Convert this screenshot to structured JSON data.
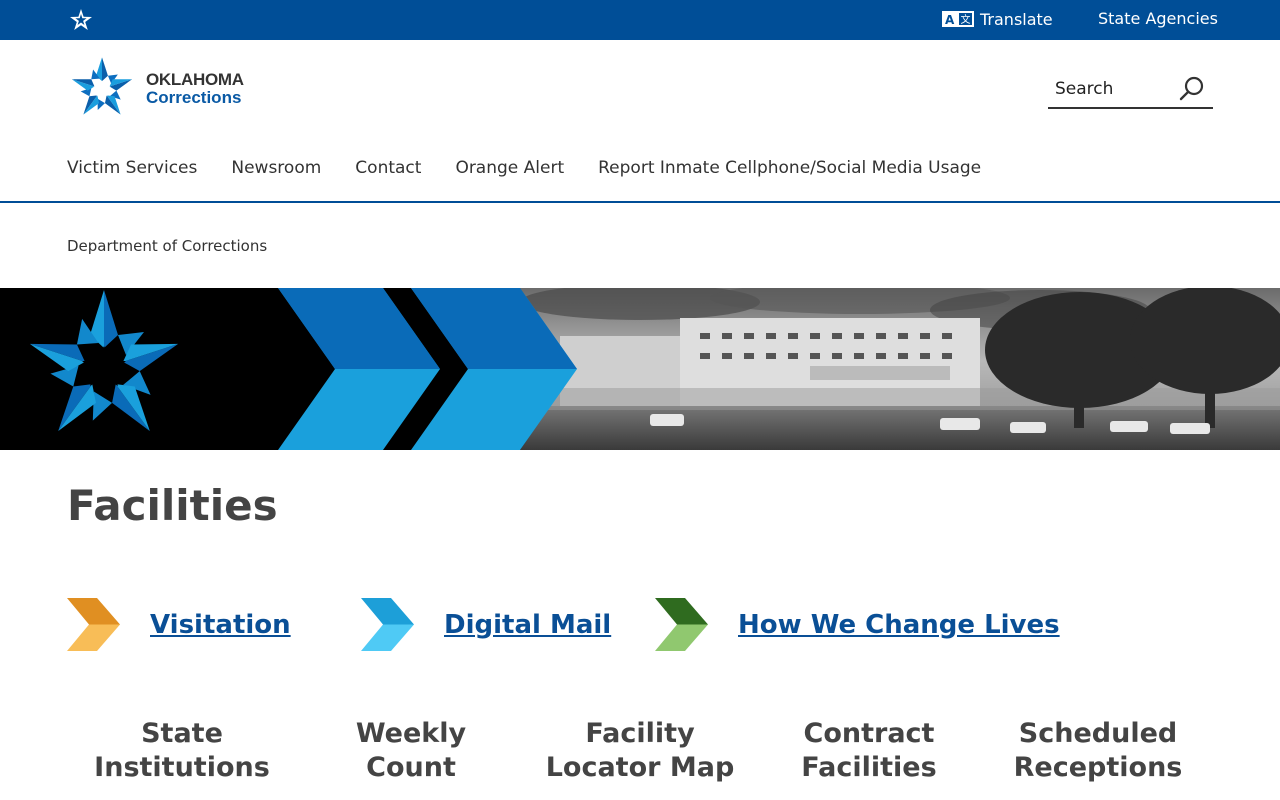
{
  "topbar": {
    "translate_label": "Translate",
    "translate_icon": "translate-icon",
    "agencies_label": "State Agencies",
    "bg_color": "#004e97"
  },
  "logo": {
    "line1": "OKLAHOMA",
    "line2": "Corrections"
  },
  "search": {
    "placeholder": "Search",
    "icon": "search-icon"
  },
  "nav": {
    "items": [
      "Victim Services",
      "Newsroom",
      "Contact",
      "Orange Alert",
      "Report Inmate Cellphone/Social Media Usage"
    ]
  },
  "breadcrumb": {
    "current": "Department of Corrections"
  },
  "page": {
    "title": "Facilities"
  },
  "quick_links": [
    {
      "label": "Visitation",
      "color_top": "#e08f22",
      "color_bottom": "#f8bd57"
    },
    {
      "label": "Digital Mail",
      "color_top": "#1d9fd8",
      "color_bottom": "#4fcaf5"
    },
    {
      "label": "How We Change Lives",
      "color_top": "#2f6b1f",
      "color_bottom": "#90c86f"
    }
  ],
  "tiles": [
    {
      "line1": "State",
      "line2": "Institutions"
    },
    {
      "line1": "Weekly",
      "line2": "Count"
    },
    {
      "line1": "Facility",
      "line2": "Locator Map"
    },
    {
      "line1": "Contract",
      "line2": "Facilities"
    },
    {
      "line1": "Scheduled",
      "line2": "Receptions"
    }
  ],
  "colors": {
    "brand_blue": "#004e97",
    "link_blue": "#0a4f96",
    "banner_blue_dark": "#0a6bb8",
    "banner_blue_light": "#1aa0dc"
  }
}
